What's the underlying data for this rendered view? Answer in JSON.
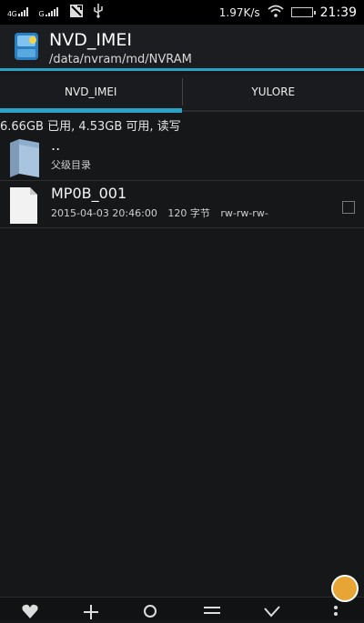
{
  "status_bar": {
    "signal1": "4G",
    "signal2": "G",
    "net_speed": "1.97K/s",
    "clock": "21:39",
    "icons": [
      "signal-icon",
      "signal-icon",
      "notification-icon",
      "usb-icon",
      "wifi-icon",
      "battery-icon"
    ]
  },
  "header": {
    "title": "NVD_IMEI",
    "path": "/data/nvram/md/NVRAM",
    "accent": "#2aa2c6"
  },
  "tabs": [
    {
      "label": "NVD_IMEI",
      "selected": true
    },
    {
      "label": "YULORE",
      "selected": false
    }
  ],
  "storage": {
    "text": "6.66GB 已用, 4.53GB 可用, 读写"
  },
  "files": [
    {
      "name": "..",
      "subtitle": "父级目录",
      "type": "folder"
    },
    {
      "name": "MP0B_001",
      "date": "2015-04-03 20:46:00",
      "size": "120 字节",
      "perms": "rw-rw-rw-",
      "type": "file"
    }
  ],
  "toolbar": {
    "icons": [
      "favorite-icon",
      "add-icon",
      "search-icon",
      "menu-icon",
      "check-icon",
      "more-icon"
    ]
  }
}
